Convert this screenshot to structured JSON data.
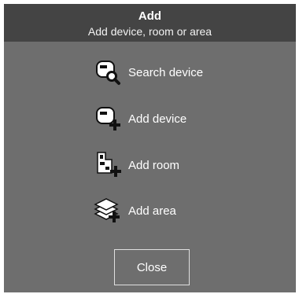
{
  "dialog": {
    "title": "Add",
    "subtitle": "Add device, room or area"
  },
  "menu": {
    "items": [
      {
        "label": "Search device",
        "icon": "search-device-icon"
      },
      {
        "label": "Add device",
        "icon": "add-device-icon"
      },
      {
        "label": "Add room",
        "icon": "add-room-icon"
      },
      {
        "label": "Add area",
        "icon": "add-area-icon"
      }
    ]
  },
  "footer": {
    "close_label": "Close"
  },
  "colors": {
    "header_bg": "#444444",
    "dialog_bg": "#6e6e6e",
    "text": "#ffffff"
  }
}
